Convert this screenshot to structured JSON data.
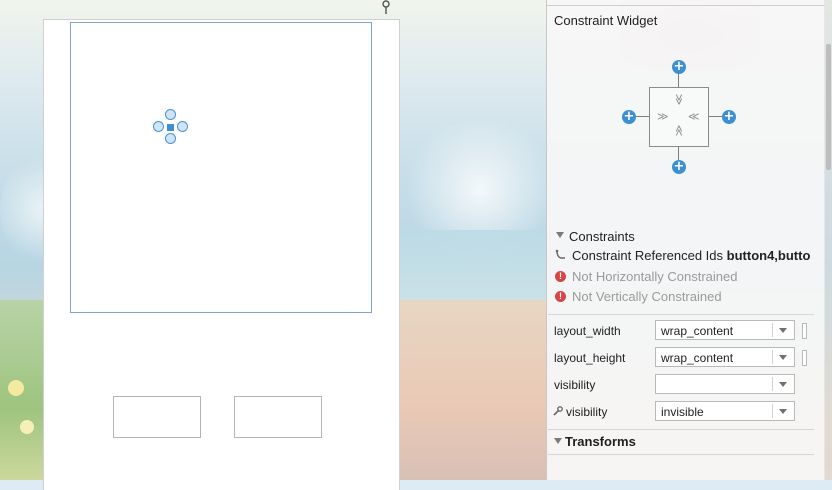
{
  "colors": {
    "accent": "#3b8fd2",
    "error": "#d64545"
  },
  "panel": {
    "widget_section_title": "Constraint Widget",
    "constraints_section_title": "Constraints",
    "referenced_ids_label": "Constraint Referenced Ids",
    "referenced_ids_value": "button4,butto",
    "warnings": [
      "Not Horizontally Constrained",
      "Not Vertically Constrained"
    ],
    "properties": [
      {
        "label": "layout_width",
        "value": "wrap_content"
      },
      {
        "label": "layout_height",
        "value": "wrap_content"
      },
      {
        "label": "visibility",
        "value": ""
      },
      {
        "label": "visibility",
        "value": "invisible"
      }
    ],
    "transforms_title": "Transforms",
    "plus_symbol": "+",
    "chevrons": {
      "top": "≫",
      "bottom": "≪",
      "left": "≫",
      "right": "≪"
    },
    "error_symbol": "!",
    "wrench_symbol": "🔧"
  },
  "icons": [
    "pin-icon",
    "chain-icon",
    "error-icon",
    "wrench-icon",
    "expand-triangle-icon",
    "dropdown-arrow-icon",
    "plus-icon"
  ]
}
